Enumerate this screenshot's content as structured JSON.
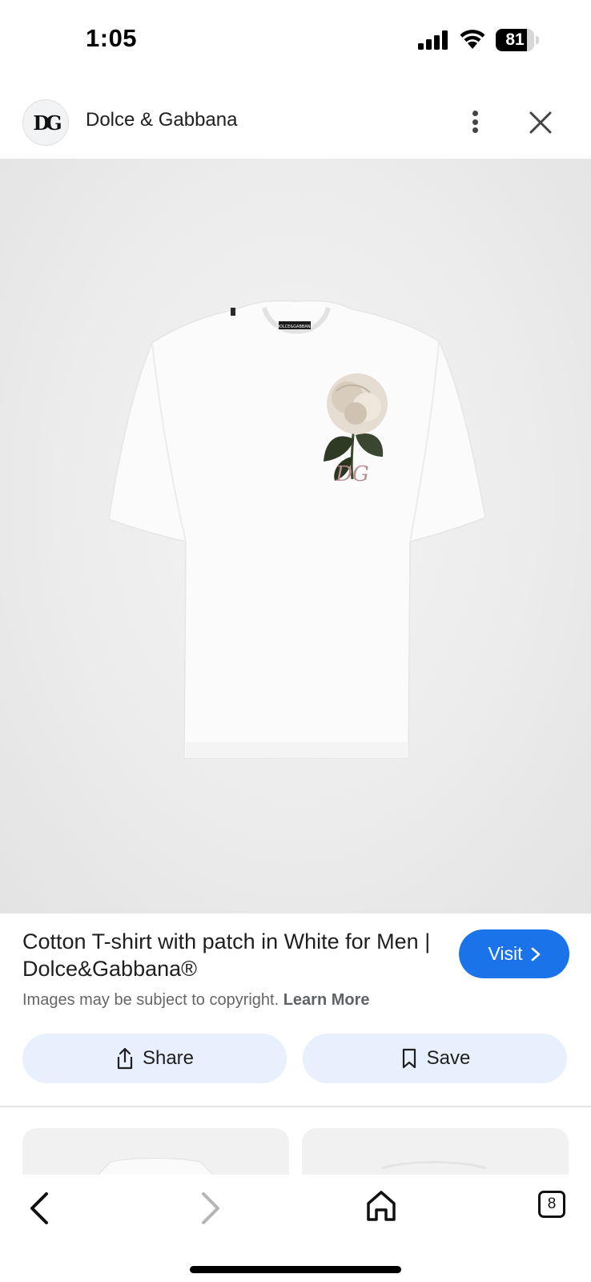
{
  "status_bar": {
    "time": "1:05",
    "battery": "81",
    "battery_level": 0.81
  },
  "header": {
    "brand_logo": "DG",
    "brand_name": "Dolce & Gabbana"
  },
  "product": {
    "title": "Cotton T-shirt with patch in White for Men | Dolce&Gabbana®",
    "copyright_text": "Images may be subject to copyright.",
    "learn_more": "Learn More",
    "visit_label": "Visit",
    "share_label": "Share",
    "save_label": "Save",
    "label_tag": "DOLCE&GABBANA",
    "patch_monogram": "DG"
  },
  "bottom_nav": {
    "tab_count": "8"
  },
  "icons": [
    "signal-icon",
    "wifi-icon",
    "more-vert-icon",
    "close-icon",
    "chevron-right-icon",
    "share-icon",
    "bookmark-icon",
    "back-icon",
    "forward-icon",
    "home-icon",
    "tabs-icon"
  ],
  "colors": {
    "accent": "#1a73e8",
    "chip_bg": "#e8f0fe",
    "image_bg": "#ececec"
  }
}
